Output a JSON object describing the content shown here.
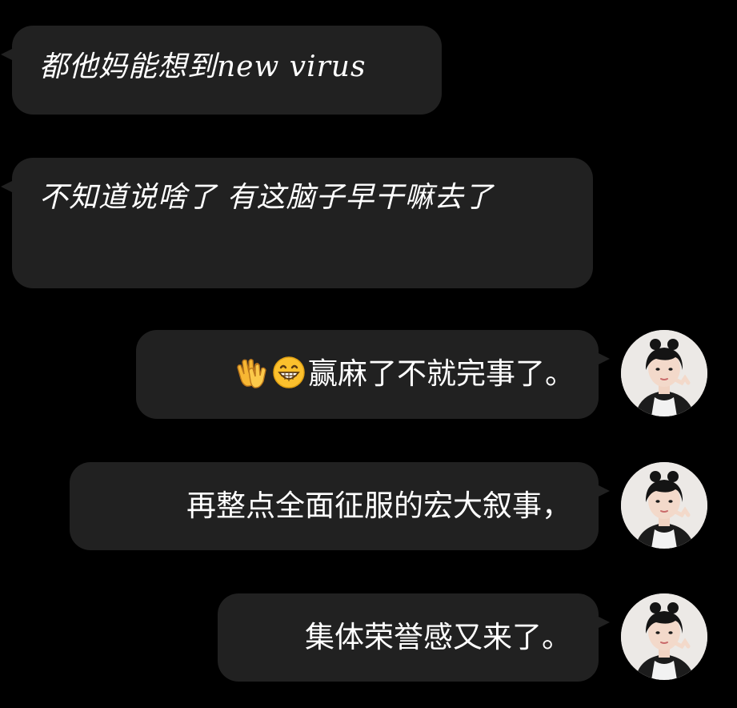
{
  "messages": [
    {
      "side": "left",
      "text": "都他妈能想到new virus"
    },
    {
      "side": "left",
      "text": "不知道说啥了 有这脑子早干嘛去了"
    },
    {
      "side": "right",
      "emojis": [
        "clapping-hands",
        "grinning-face"
      ],
      "text": "赢麻了不就完事了。"
    },
    {
      "side": "right",
      "text": "再整点全面征服的宏大叙事，"
    },
    {
      "side": "right",
      "text": "集体荣誉感又来了。"
    }
  ],
  "colors": {
    "background": "#000000",
    "bubble": "#212121",
    "text": "#ffffff"
  }
}
